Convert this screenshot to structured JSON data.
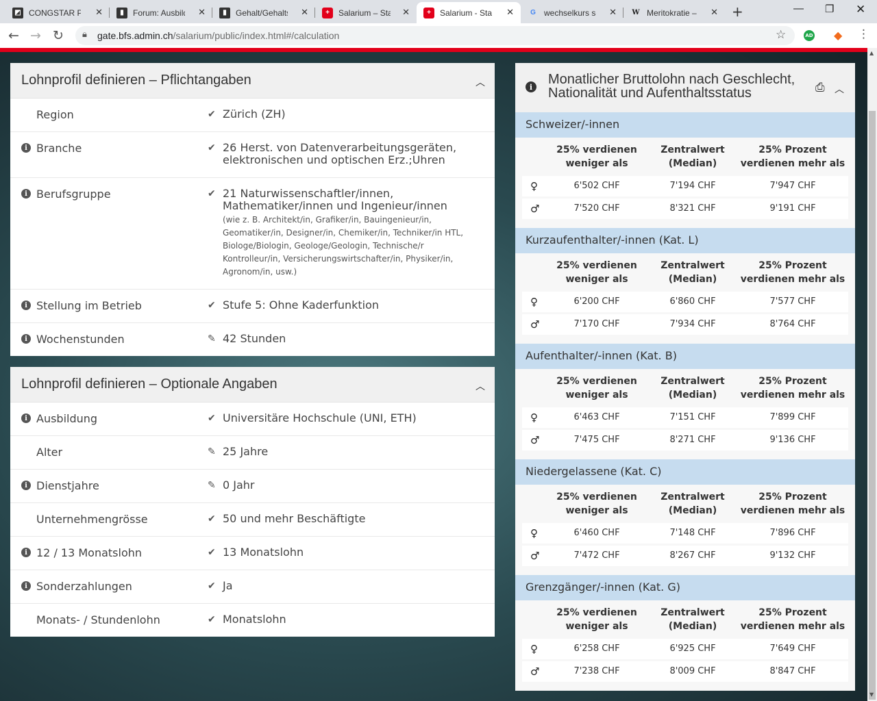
{
  "browser": {
    "tabs": [
      {
        "title": "CONGSTAR PRE",
        "icon": "congstar-icon"
      },
      {
        "title": "Forum: Ausbildu",
        "icon": "document-icon"
      },
      {
        "title": "Gehalt/Gehaltse",
        "icon": "document-icon"
      },
      {
        "title": "Salarium – Statis",
        "icon": "swiss-cross-icon"
      },
      {
        "title": "Salarium - Statis",
        "icon": "swiss-cross-icon"
      },
      {
        "title": "wechselkurs sch",
        "icon": "google-icon"
      },
      {
        "title": "Meritokratie – W",
        "icon": "wikipedia-icon"
      }
    ],
    "url_domain": "gate.bfs.admin.ch",
    "url_path": "/salarium/public/index.html#/calculation",
    "extension_label": "AD"
  },
  "required_panel": {
    "title": "Lohnprofil definieren – Pflichtangaben",
    "rows": [
      {
        "label": "Region",
        "value": "Zürich (ZH)",
        "info": false,
        "icon": "check"
      },
      {
        "label": "Branche",
        "value": "26 Herst. von Datenverarbeitungsgeräten, elektronischen und optischen Erz.;Uhren",
        "info": true,
        "icon": "check"
      },
      {
        "label": "Berufsgruppe",
        "value": "21 Naturwissenschaftler/innen, Mathematiker/innen und Ingenieur/innen",
        "sub": "(wie z. B. Architekt/in, Grafiker/in, Bauingenieur/in, Geomatiker/in, Designer/in, Chemiker/in, Techniker/in HTL, Biologe/Biologin, Geologe/Geologin, Technische/r Kontrolleur/in, Versicherungswirtschafter/in, Physiker/in, Agronom/in, usw.)",
        "info": true,
        "icon": "check"
      },
      {
        "label": "Stellung im Betrieb",
        "value": "Stufe 5: Ohne Kaderfunktion",
        "info": true,
        "icon": "check"
      },
      {
        "label": "Wochenstunden",
        "value": "42  Stunden",
        "info": true,
        "icon": "pencil"
      }
    ]
  },
  "optional_panel": {
    "title": "Lohnprofil definieren – Optionale Angaben",
    "rows": [
      {
        "label": "Ausbildung",
        "value": "Universitäre Hochschule (UNI, ETH)",
        "info": true,
        "icon": "check"
      },
      {
        "label": "Alter",
        "value": "25 Jahre",
        "info": false,
        "icon": "pencil"
      },
      {
        "label": "Dienstjahre",
        "value": "0 Jahr",
        "info": true,
        "icon": "pencil"
      },
      {
        "label": "Unternehmengrösse",
        "value": "50 und mehr Beschäftigte",
        "info": false,
        "icon": "check"
      },
      {
        "label": "12 / 13 Monatslohn",
        "value": "13 Monatslohn",
        "info": true,
        "icon": "check"
      },
      {
        "label": "Sonderzahlungen",
        "value": "Ja",
        "info": true,
        "icon": "check"
      },
      {
        "label": "Monats- / Stundenlohn",
        "value": "Monatslohn",
        "info": false,
        "icon": "check"
      }
    ]
  },
  "results": {
    "title": "Monatlicher Bruttolohn nach Geschlecht, Nationalität und Aufenthaltsstatus",
    "columns": [
      "25% verdienen weniger als",
      "Zentralwert (Median)",
      "25% Prozent verdienen mehr als"
    ],
    "sections": [
      {
        "name": "Schweizer/-innen",
        "rows": [
          {
            "gender": "female-icon",
            "values": [
              "6'502 CHF",
              "7'194 CHF",
              "7'947 CHF"
            ]
          },
          {
            "gender": "male-icon",
            "values": [
              "7'520 CHF",
              "8'321 CHF",
              "9'191 CHF"
            ]
          }
        ]
      },
      {
        "name": "Kurzaufenthalter/-innen (Kat. L)",
        "rows": [
          {
            "gender": "female-icon",
            "values": [
              "6'200 CHF",
              "6'860 CHF",
              "7'577 CHF"
            ]
          },
          {
            "gender": "male-icon",
            "values": [
              "7'170 CHF",
              "7'934 CHF",
              "8'764 CHF"
            ]
          }
        ]
      },
      {
        "name": "Aufenthalter/-innen (Kat. B)",
        "rows": [
          {
            "gender": "female-icon",
            "values": [
              "6'463 CHF",
              "7'151 CHF",
              "7'899 CHF"
            ]
          },
          {
            "gender": "male-icon",
            "values": [
              "7'475 CHF",
              "8'271 CHF",
              "9'136 CHF"
            ]
          }
        ]
      },
      {
        "name": "Niedergelassene (Kat. C)",
        "rows": [
          {
            "gender": "female-icon",
            "values": [
              "6'460 CHF",
              "7'148 CHF",
              "7'896 CHF"
            ]
          },
          {
            "gender": "male-icon",
            "values": [
              "7'472 CHF",
              "8'267 CHF",
              "9'132 CHF"
            ]
          }
        ]
      },
      {
        "name": "Grenzgänger/-innen (Kat. G)",
        "rows": [
          {
            "gender": "female-icon",
            "values": [
              "6'258 CHF",
              "6'925 CHF",
              "7'649 CHF"
            ]
          },
          {
            "gender": "male-icon",
            "values": [
              "7'238 CHF",
              "8'009 CHF",
              "8'847 CHF"
            ]
          }
        ]
      }
    ]
  },
  "colors": {
    "brand_red": "#e2001a",
    "section_blue": "#c6dcef"
  }
}
